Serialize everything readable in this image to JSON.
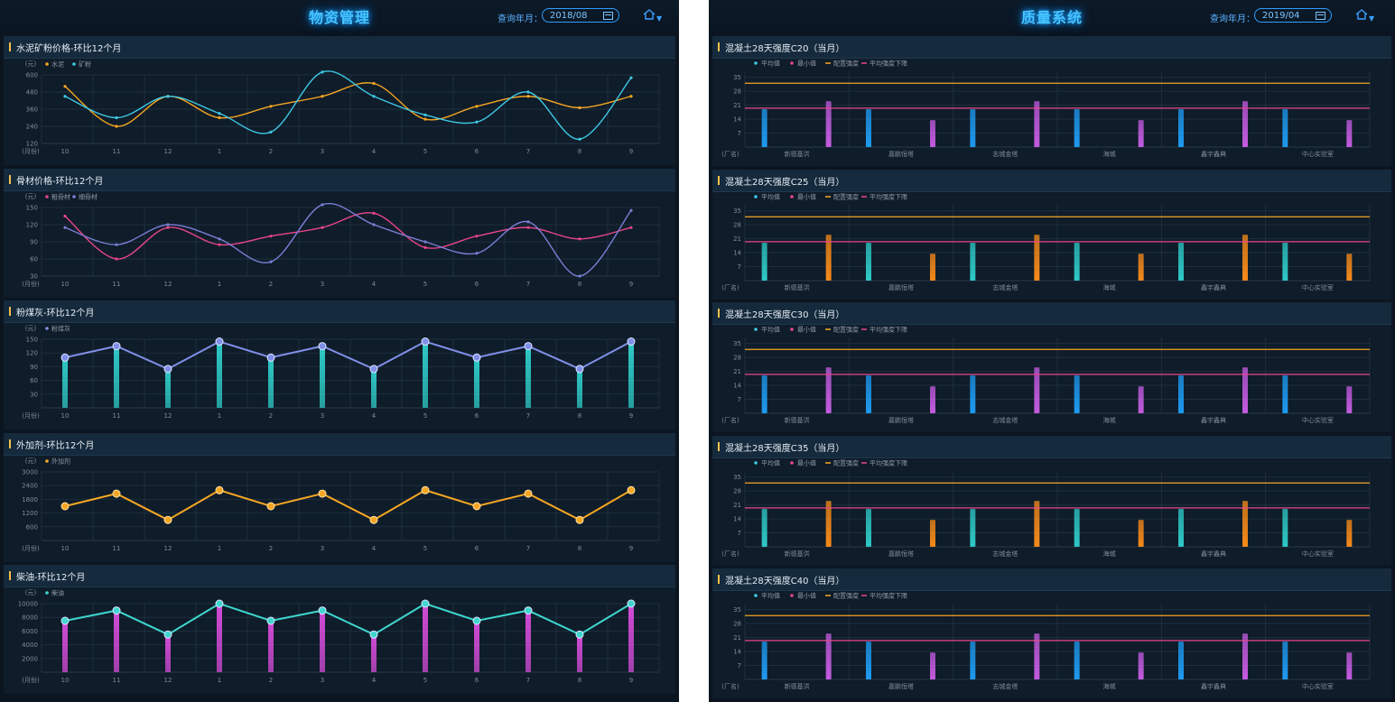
{
  "left": {
    "title": "物资管理",
    "query_label": "查询年月：",
    "query_value": "2018/08",
    "home_icon": "home-icon",
    "x_categories": [
      "10",
      "11",
      "12",
      "1",
      "2",
      "3",
      "4",
      "5",
      "6",
      "7",
      "8",
      "9"
    ],
    "x_unit": "(月份)",
    "y_unit": "(元)",
    "charts": [
      {
        "title": "水泥矿粉价格-环比12个月",
        "type": "line",
        "ylim": [
          120,
          600
        ],
        "yticks": [
          600,
          480,
          360,
          240,
          120
        ],
        "series": [
          {
            "name": "水泥",
            "color": "#f5a623",
            "values": [
              520,
              240,
              450,
              300,
              380,
              450,
              540,
              290,
              380,
              450,
              370,
              450
            ]
          },
          {
            "name": "矿粉",
            "color": "#3ec8e6",
            "values": [
              450,
              300,
              450,
              330,
              200,
              620,
              450,
              320,
              270,
              480,
              150,
              580
            ]
          }
        ]
      },
      {
        "title": "骨材价格-环比12个月",
        "type": "line",
        "ylim": [
          30,
          150
        ],
        "yticks": [
          150,
          120,
          90,
          60,
          30
        ],
        "series": [
          {
            "name": "粗骨材",
            "color": "#e8468a",
            "values": [
              135,
              60,
              115,
              85,
              100,
              115,
              140,
              80,
              100,
              115,
              95,
              115
            ]
          },
          {
            "name": "细骨材",
            "color": "#7a7fd6",
            "values": [
              115,
              85,
              120,
              95,
              55,
              155,
              120,
              90,
              70,
              125,
              30,
              145
            ]
          }
        ]
      },
      {
        "title": "粉煤灰-环比12个月",
        "type": "bar-line",
        "ylim": [
          0,
          150
        ],
        "yticks": [
          150,
          120,
          90,
          60,
          30
        ],
        "series": [
          {
            "name": "粉煤灰",
            "color": "#7f8fe8",
            "bar_color": "#2ec9c6",
            "values": [
              110,
              135,
              85,
              145,
              110,
              135,
              85,
              145,
              110,
              135,
              85,
              145
            ]
          }
        ]
      },
      {
        "title": "外加剂-环比12个月",
        "type": "line",
        "ylim": [
          0,
          3000
        ],
        "yticks": [
          3000,
          2400,
          1800,
          1200,
          600
        ],
        "series": [
          {
            "name": "外加剂",
            "color": "#f5a623",
            "values": [
              1500,
              2050,
              900,
              2200,
              1500,
              2050,
              900,
              2200,
              1500,
              2050,
              900,
              2200
            ]
          }
        ]
      },
      {
        "title": "柴油-环比12个月",
        "type": "bar-line",
        "ylim": [
          0,
          10000
        ],
        "yticks": [
          10000,
          8000,
          6000,
          4000,
          2000
        ],
        "series": [
          {
            "name": "柴油",
            "color": "#3ed6cf",
            "bar_color": "#d14bd6",
            "values": [
              7500,
              9000,
              5500,
              10000,
              7500,
              9000,
              5500,
              10000,
              7500,
              9000,
              5500,
              10000
            ]
          }
        ]
      }
    ]
  },
  "right": {
    "title": "质量系统",
    "query_label": "查询年月：",
    "query_value": "2019/04",
    "home_icon": "home-icon",
    "x_unit": "(厂名)",
    "categories": [
      "新德基洪",
      "嘉鹏恒塔",
      "志城金塔",
      "海城",
      "鑫宇鑫典",
      "中心实验室"
    ],
    "legend": [
      {
        "name": "平均值",
        "color": "#3ec8e6",
        "kind": "dot"
      },
      {
        "name": "最小值",
        "color": "#e8468a",
        "kind": "dot"
      },
      {
        "name": "配置强度",
        "color": "#f5a623",
        "kind": "line"
      },
      {
        "name": "平均强度下限",
        "color": "#e8468a",
        "kind": "line"
      }
    ],
    "yticks": [
      35,
      28,
      21,
      14,
      7
    ],
    "ylim": [
      0,
      38
    ],
    "charts": [
      {
        "title": "混凝土28天强度C20（当月）",
        "avg": [
          19,
          19,
          19,
          19,
          19,
          19
        ],
        "min": [
          23,
          13.5,
          23,
          13.5,
          23,
          13.5
        ],
        "config": 32,
        "lower": 19.5,
        "avg_color": "#1e9af0",
        "min_color": "#c35be0"
      },
      {
        "title": "混凝土28天强度C25（当月）",
        "avg": [
          19,
          19,
          19,
          19,
          19,
          19
        ],
        "min": [
          23,
          13.5,
          23,
          13.5,
          23,
          13.5
        ],
        "config": 32,
        "lower": 19.5,
        "avg_color": "#2ec9c6",
        "min_color": "#f58a1a"
      },
      {
        "title": "混凝土28天强度C30（当月）",
        "avg": [
          19,
          19,
          19,
          19,
          19,
          19
        ],
        "min": [
          23,
          13.5,
          23,
          13.5,
          23,
          13.5
        ],
        "config": 32,
        "lower": 19.5,
        "avg_color": "#1e9af0",
        "min_color": "#c35be0"
      },
      {
        "title": "混凝土28天强度C35（当月）",
        "avg": [
          19,
          19,
          19,
          19,
          19,
          19
        ],
        "min": [
          23,
          13.5,
          23,
          13.5,
          23,
          13.5
        ],
        "config": 32,
        "lower": 19.5,
        "avg_color": "#2ec9c6",
        "min_color": "#f58a1a"
      },
      {
        "title": "混凝土28天强度C40（当月）",
        "avg": [
          19,
          19,
          19,
          19,
          19,
          19
        ],
        "min": [
          23,
          13.5,
          23,
          13.5,
          23,
          13.5
        ],
        "config": 32,
        "lower": 19.5,
        "avg_color": "#1e9af0",
        "min_color": "#c35be0"
      }
    ]
  }
}
